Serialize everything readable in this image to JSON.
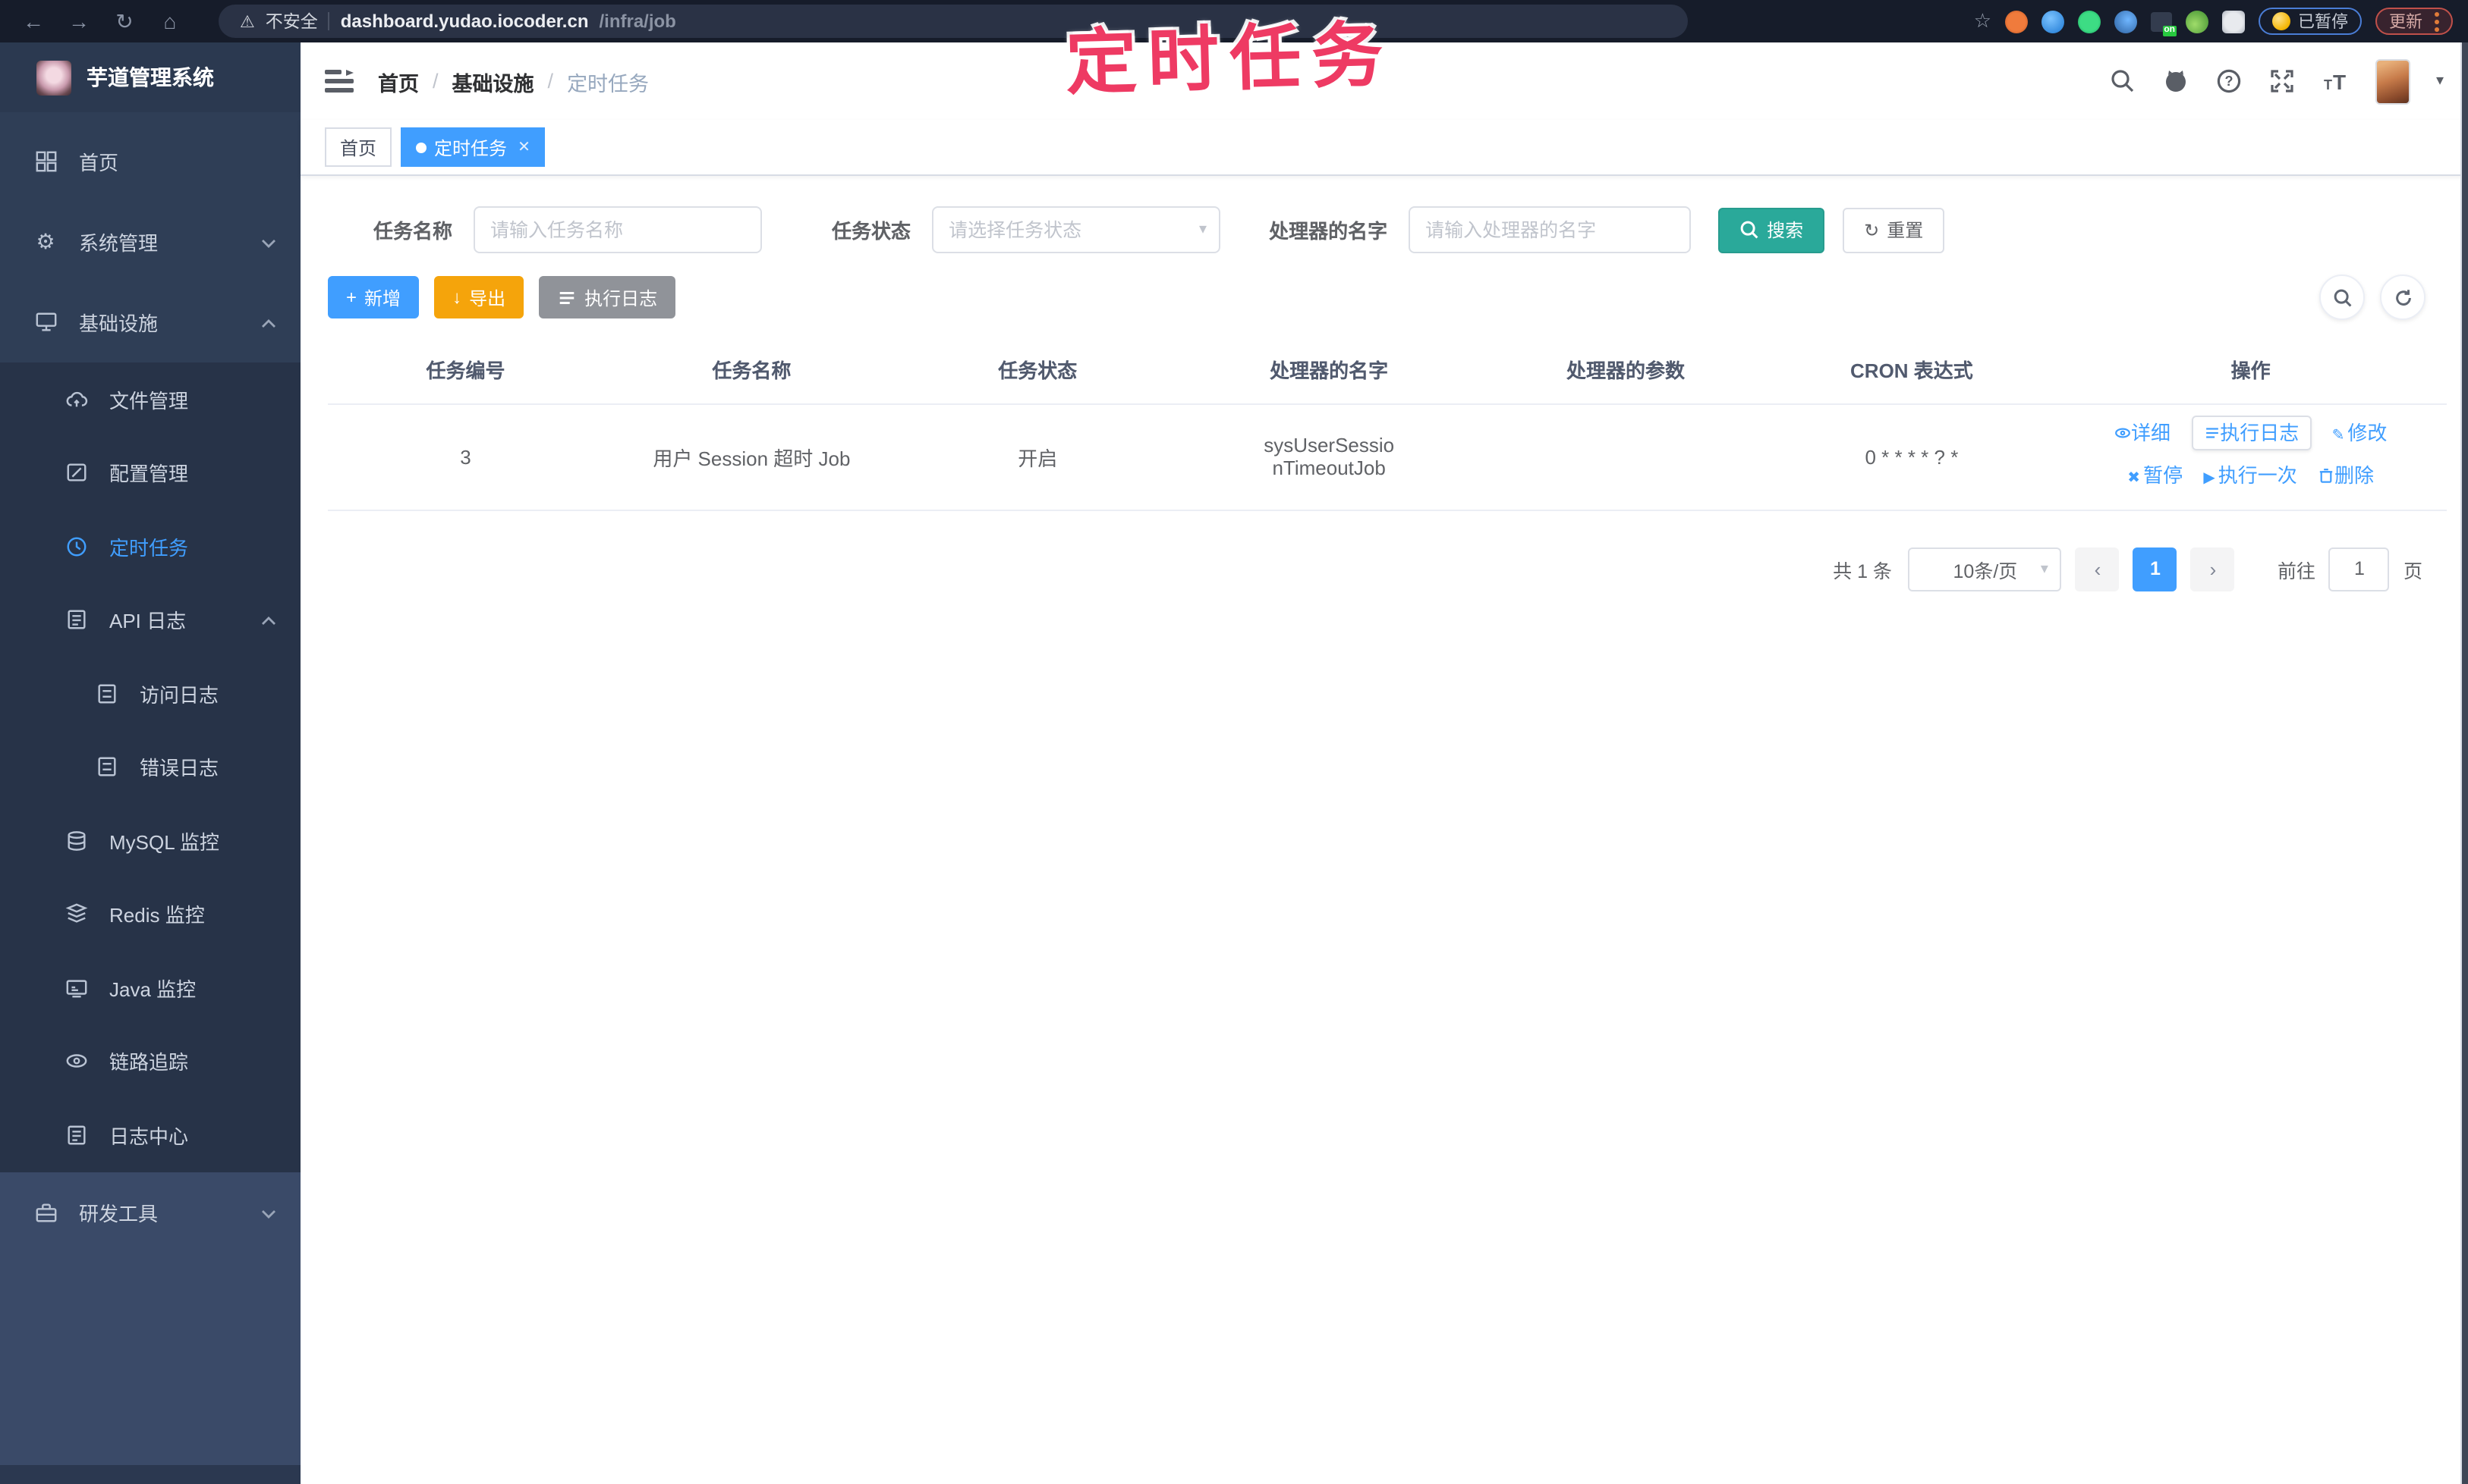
{
  "browser": {
    "security_label": "不安全",
    "url_host": "dashboard.yudao.iocoder.cn",
    "url_path": "/infra/job",
    "extension_badge": "on",
    "paused_button": "已暂停",
    "update_button": "更新"
  },
  "annotation": {
    "text": "定时任务"
  },
  "sidebar": {
    "title": "芋道管理系统",
    "items": [
      {
        "label": "首页",
        "icon": "dashboard-icon"
      },
      {
        "label": "系统管理",
        "icon": "gear-icon",
        "chevron": "down"
      },
      {
        "label": "基础设施",
        "icon": "infrastructure-icon",
        "chevron": "up"
      },
      {
        "label": "文件管理",
        "icon": "file-cloud-icon"
      },
      {
        "label": "配置管理",
        "icon": "config-edit-icon"
      },
      {
        "label": "定时任务",
        "icon": "clock-icon",
        "active": true
      },
      {
        "label": "API 日志",
        "icon": "api-log-icon",
        "chevron": "up"
      },
      {
        "label": "访问日志",
        "icon": "access-log-icon"
      },
      {
        "label": "错误日志",
        "icon": "error-log-icon"
      },
      {
        "label": "MySQL 监控",
        "icon": "mysql-icon"
      },
      {
        "label": "Redis 监控",
        "icon": "redis-icon"
      },
      {
        "label": "Java 监控",
        "icon": "java-icon"
      },
      {
        "label": "链路追踪",
        "icon": "trace-eye-icon"
      },
      {
        "label": "日志中心",
        "icon": "log-center-icon"
      },
      {
        "label": "研发工具",
        "icon": "devtools-icon",
        "chevron": "down"
      }
    ]
  },
  "header": {
    "breadcrumb": [
      "首页",
      "基础设施",
      "定时任务"
    ]
  },
  "tabs": [
    {
      "label": "首页",
      "active": false
    },
    {
      "label": "定时任务",
      "active": true
    }
  ],
  "filters": {
    "name_label": "任务名称",
    "name_placeholder": "请输入任务名称",
    "status_label": "任务状态",
    "status_placeholder": "请选择任务状态",
    "handler_label": "处理器的名字",
    "handler_placeholder": "请输入处理器的名字",
    "search_label": "搜索",
    "reset_label": "重置"
  },
  "toolbar": {
    "add_label": "新增",
    "export_label": "导出",
    "exec_log_label": "执行日志"
  },
  "table": {
    "headers": [
      "任务编号",
      "任务名称",
      "任务状态",
      "处理器的名字",
      "处理器的参数",
      "CRON 表达式",
      "操作"
    ],
    "row": {
      "id": "3",
      "name": "用户 Session 超时 Job",
      "status": "开启",
      "handler": "sysUserSessionTimeoutJob",
      "param": "",
      "cron": "0 * * * * ? *"
    },
    "operations": [
      "详细",
      "执行日志",
      "修改",
      "暂停",
      "执行一次",
      "删除"
    ]
  },
  "pagination": {
    "total": "共 1 条",
    "page_size": "10条/页",
    "current_page": "1",
    "goto_label": "前往",
    "goto_value": "1",
    "unit_label": "页"
  },
  "colors": {
    "accent": "#409eff",
    "search_button": "#2aa99a",
    "export_button": "#f5a40b",
    "info_button": "#909399",
    "annotation": "#ee3a63",
    "sidebar_bg": "#2f3e56",
    "submenu_bg": "#273348"
  }
}
